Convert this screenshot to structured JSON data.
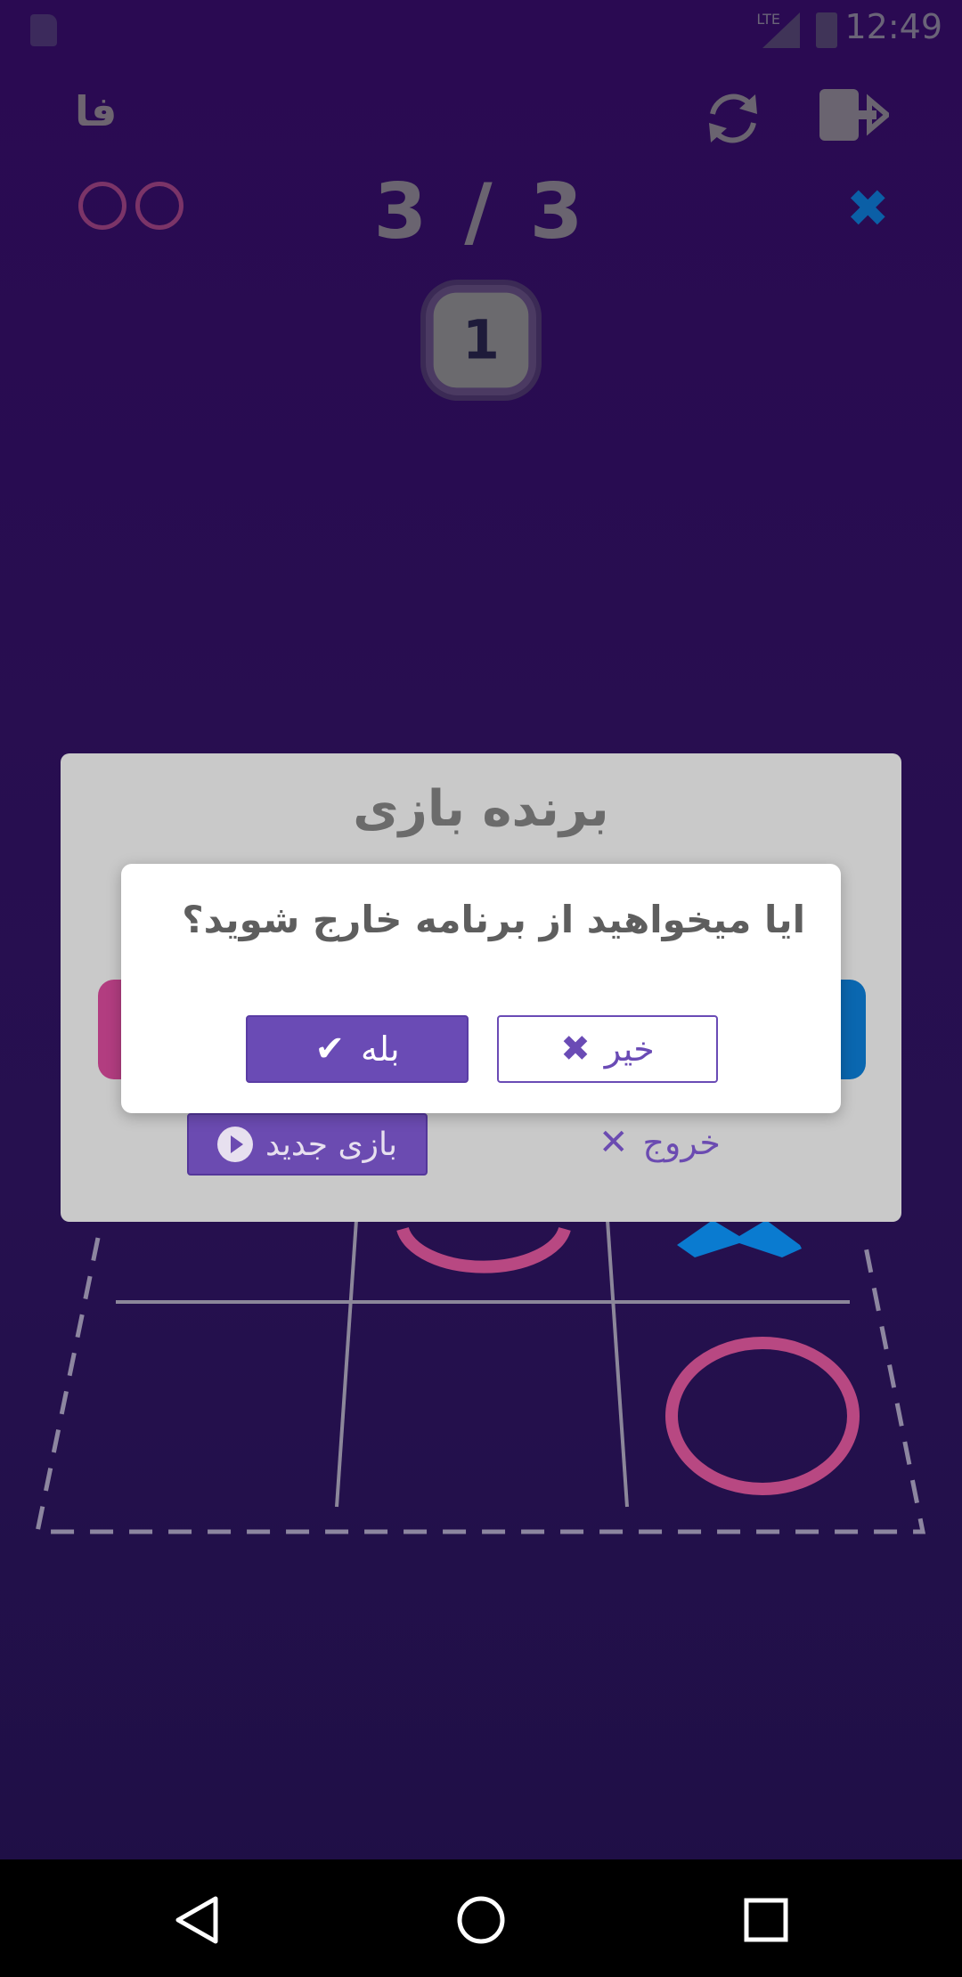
{
  "status_bar": {
    "time": "12:49",
    "network": "LTE",
    "icons": [
      "sd-card-icon",
      "lte-signal-icon",
      "battery-charging-icon"
    ]
  },
  "header": {
    "language_label": "فا",
    "refresh_icon": "refresh-icon",
    "exit_icon": "exit-icon"
  },
  "game": {
    "score": "3 / 3",
    "player_o_marks": 2,
    "player_x_mark": "✖",
    "round": "1"
  },
  "winner_dialog": {
    "title": "برنده بازی",
    "new_game_label": "بازی جدید",
    "exit_label": "خروج"
  },
  "confirm_dialog": {
    "message": "ایا میخواهید از برنامه خارج شوید؟",
    "yes_label": "بله",
    "no_label": "خیر"
  },
  "colors": {
    "accent": "#6a4bb5",
    "o_color": "#b84882",
    "x_color": "#0a7bd0",
    "background": "#26104f"
  },
  "nav_bar": {
    "icons": [
      "back-icon",
      "home-icon",
      "recents-icon"
    ]
  }
}
